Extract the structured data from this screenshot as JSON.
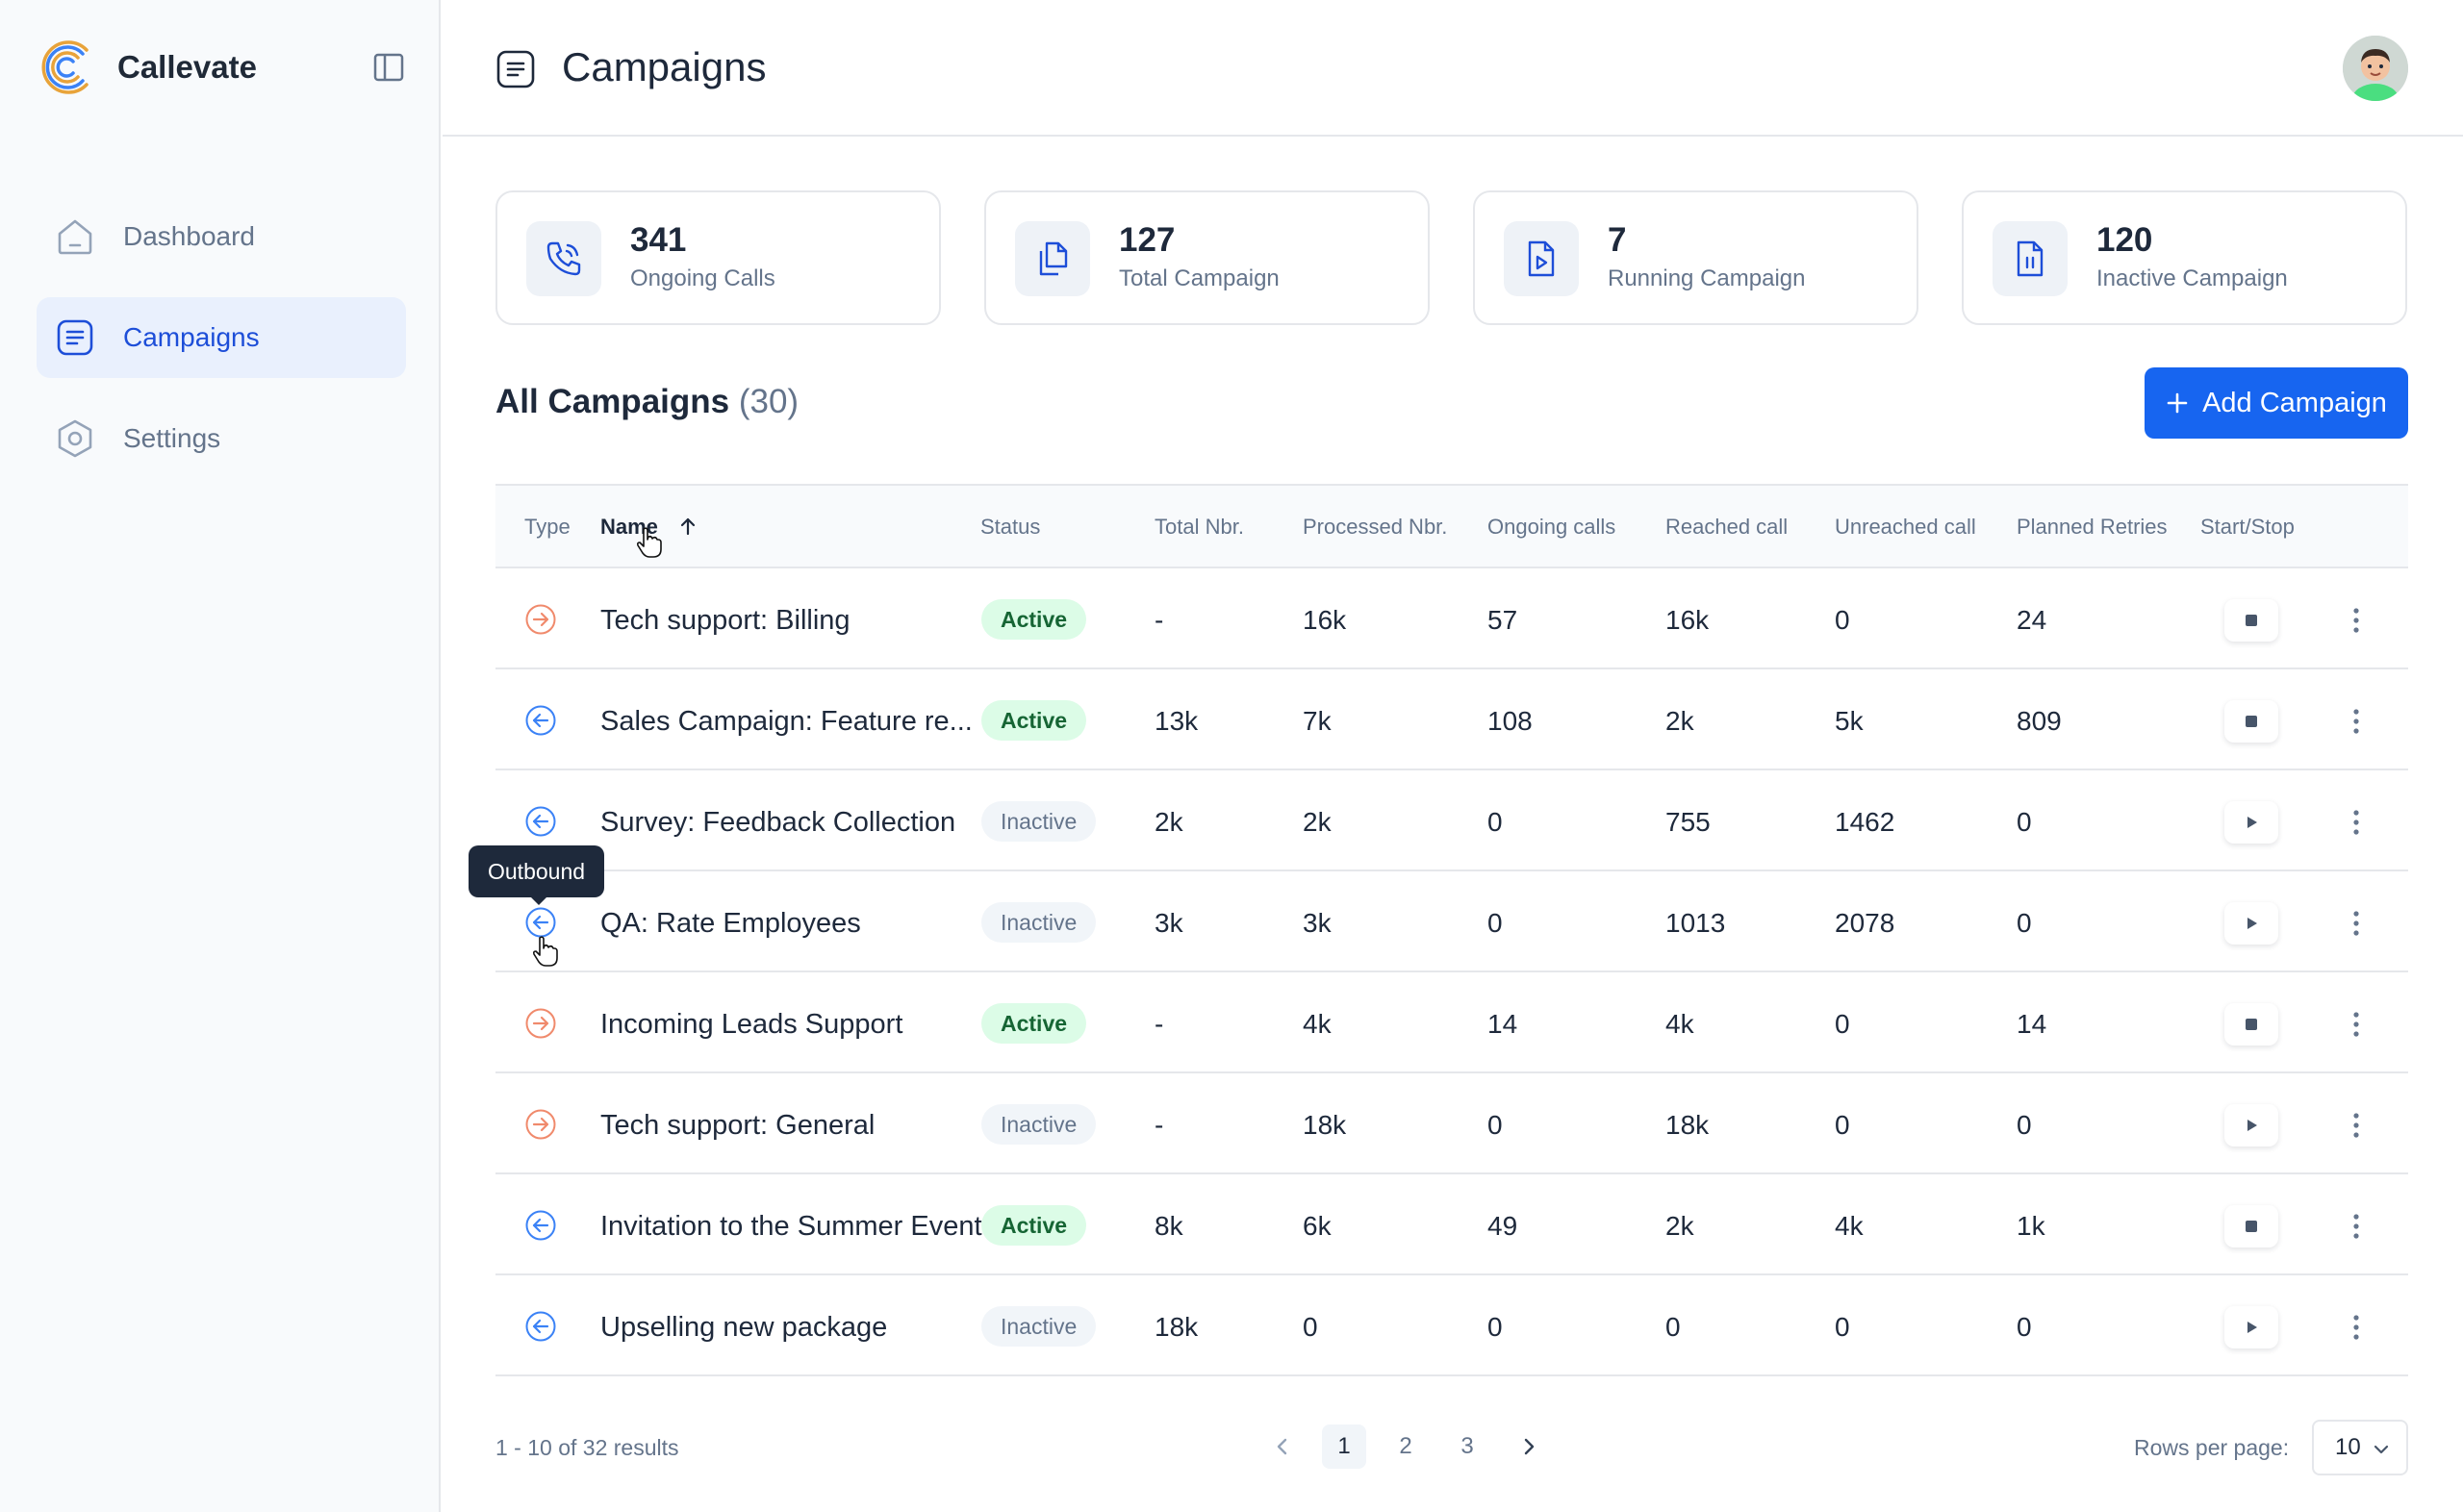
{
  "app": {
    "name": "Callevate"
  },
  "sidebar": {
    "items": [
      {
        "label": "Dashboard",
        "icon": "home-icon",
        "active": false
      },
      {
        "label": "Campaigns",
        "icon": "list-icon",
        "active": true
      },
      {
        "label": "Settings",
        "icon": "gear-icon",
        "active": false
      }
    ]
  },
  "header": {
    "title": "Campaigns"
  },
  "stats": [
    {
      "value": "341",
      "label": "Ongoing Calls",
      "icon": "phone-icon"
    },
    {
      "value": "127",
      "label": "Total Campaign",
      "icon": "copy-files-icon"
    },
    {
      "value": "7",
      "label": "Running Campaign",
      "icon": "play-file-icon"
    },
    {
      "value": "120",
      "label": "Inactive Campaign",
      "icon": "pause-file-icon"
    }
  ],
  "campaigns_section": {
    "title": "All Campaigns",
    "count": "(30)",
    "add_label": "Add Campaign"
  },
  "table": {
    "headers": {
      "type": "Type",
      "name": "Name",
      "status": "Status",
      "total": "Total Nbr.",
      "processed": "Processed Nbr.",
      "ongoing": "Ongoing calls",
      "reached": "Reached call",
      "unreached": "Unreached call",
      "retries": "Planned Retries",
      "startstop": "Start/Stop"
    },
    "rows": [
      {
        "type": "inbound",
        "name": "Tech support: Billing",
        "status": "Active",
        "total": "-",
        "processed": "16k",
        "ongoing": "57",
        "reached": "16k",
        "unreached": "0",
        "retries": "24",
        "action": "stop"
      },
      {
        "type": "outbound",
        "name": "Sales Campaign: Feature re...",
        "status": "Active",
        "total": "13k",
        "processed": "7k",
        "ongoing": "108",
        "reached": "2k",
        "unreached": "5k",
        "retries": "809",
        "action": "stop"
      },
      {
        "type": "outbound",
        "name": "Survey: Feedback Collection",
        "status": "Inactive",
        "total": "2k",
        "processed": "2k",
        "ongoing": "0",
        "reached": "755",
        "unreached": "1462",
        "retries": "0",
        "action": "play"
      },
      {
        "type": "outbound",
        "name": "QA: Rate Employees",
        "status": "Inactive",
        "total": "3k",
        "processed": "3k",
        "ongoing": "0",
        "reached": "1013",
        "unreached": "2078",
        "retries": "0",
        "action": "play"
      },
      {
        "type": "inbound",
        "name": "Incoming Leads Support",
        "status": "Active",
        "total": "-",
        "processed": "4k",
        "ongoing": "14",
        "reached": "4k",
        "unreached": "0",
        "retries": "14",
        "action": "stop"
      },
      {
        "type": "inbound",
        "name": "Tech support: General",
        "status": "Inactive",
        "total": "-",
        "processed": "18k",
        "ongoing": "0",
        "reached": "18k",
        "unreached": "0",
        "retries": "0",
        "action": "play"
      },
      {
        "type": "outbound",
        "name": "Invitation to the Summer Event",
        "status": "Active",
        "total": "8k",
        "processed": "6k",
        "ongoing": "49",
        "reached": "2k",
        "unreached": "4k",
        "retries": "1k",
        "action": "stop"
      },
      {
        "type": "outbound",
        "name": "Upselling new package",
        "status": "Inactive",
        "total": "18k",
        "processed": "0",
        "ongoing": "0",
        "reached": "0",
        "unreached": "0",
        "retries": "0",
        "action": "play"
      }
    ]
  },
  "tooltip": {
    "text": "Outbound"
  },
  "footer": {
    "results": "1 - 10 of 32 results",
    "pages": [
      "1",
      "2",
      "3"
    ],
    "current_page": "1",
    "rows_label": "Rows per page:",
    "rows_value": "10"
  },
  "colors": {
    "primary": "#1765f0",
    "inbound": "#f08a6c",
    "outbound": "#3b82f6",
    "active_bg": "#dcfce7",
    "active_text": "#166534"
  }
}
